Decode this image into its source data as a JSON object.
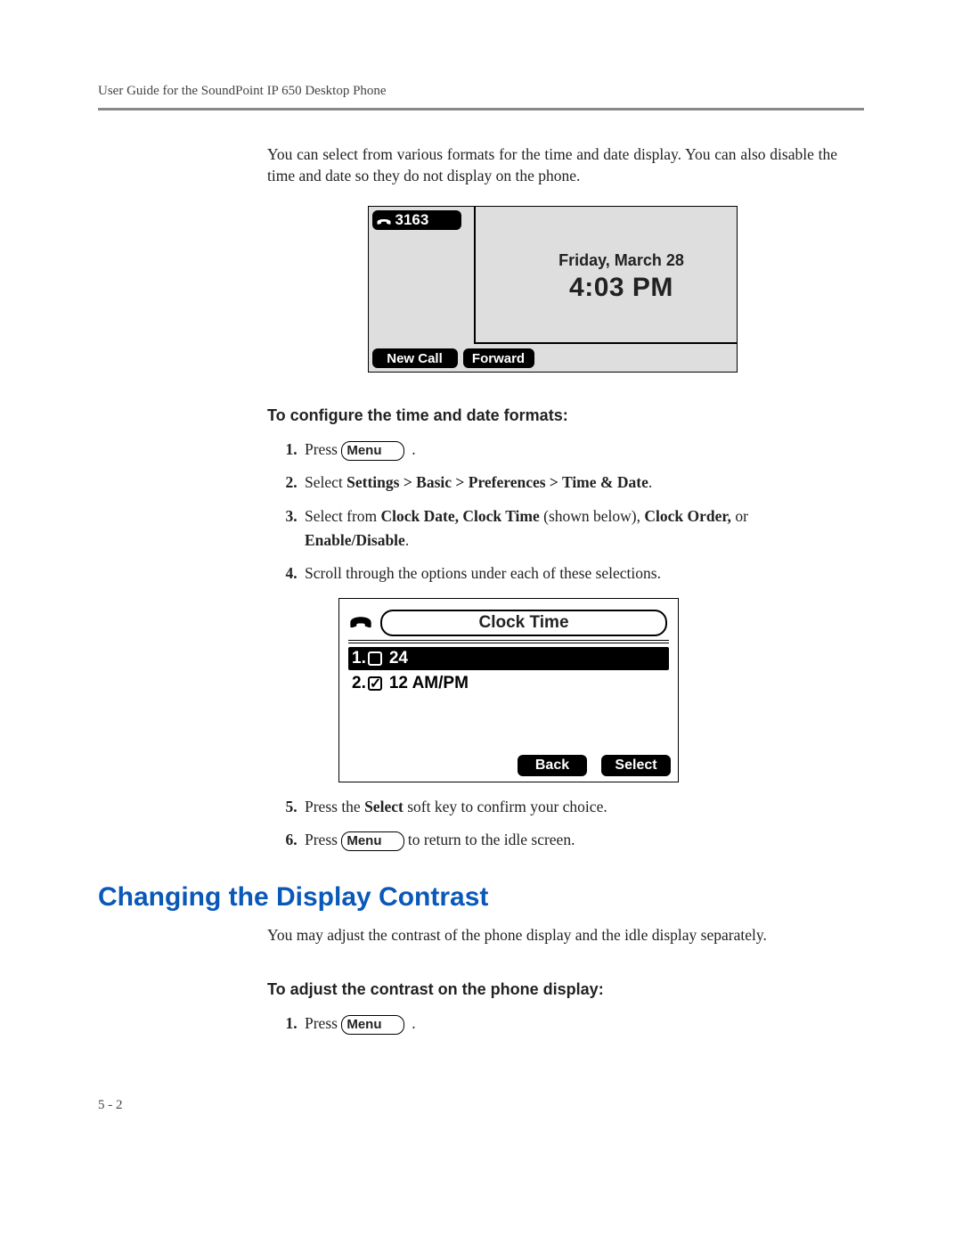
{
  "header": "User Guide for the SoundPoint IP 650 Desktop Phone",
  "intro": "You can select from various formats for the time and date display. You can also disable the time and date so they do not display on the phone.",
  "fig1": {
    "extension": "3163",
    "date": "Friday, March 28",
    "time": "4:03 PM",
    "softkeys": [
      "New Call",
      "Forward"
    ]
  },
  "section1_title": "To configure the time and date formats:",
  "s1_press": "Press ",
  "menu_label": "Menu",
  "s2a": "Select ",
  "s2b": "Settings > Basic > Preferences > Time & Date",
  "s3a": "Select from ",
  "s3b": "Clock Date, Clock Time",
  "s3c": " (shown below), ",
  "s3d": "Clock Order,",
  "s3e": " or ",
  "s3f": "Enable/Disable",
  "s4": "Scroll through the options under each of these selections.",
  "fig2": {
    "title": "Clock Time",
    "options": [
      {
        "num": "1.",
        "label": "24",
        "checked": false
      },
      {
        "num": "2.",
        "label": "12 AM/PM",
        "checked": true
      }
    ],
    "softkeys": [
      "Back",
      "Select"
    ]
  },
  "s5a": "Press the ",
  "s5b": "Select",
  "s5c": " soft key to confirm your choice.",
  "s6a": "Press ",
  "s6b": " to return to the idle screen.",
  "h2": "Changing the Display Contrast",
  "contrast_intro": "You may adjust the contrast of the phone display and the idle display separately.",
  "section2_title": "To adjust the contrast on the phone display:",
  "c1_press": "Press ",
  "footer": "5 - 2"
}
